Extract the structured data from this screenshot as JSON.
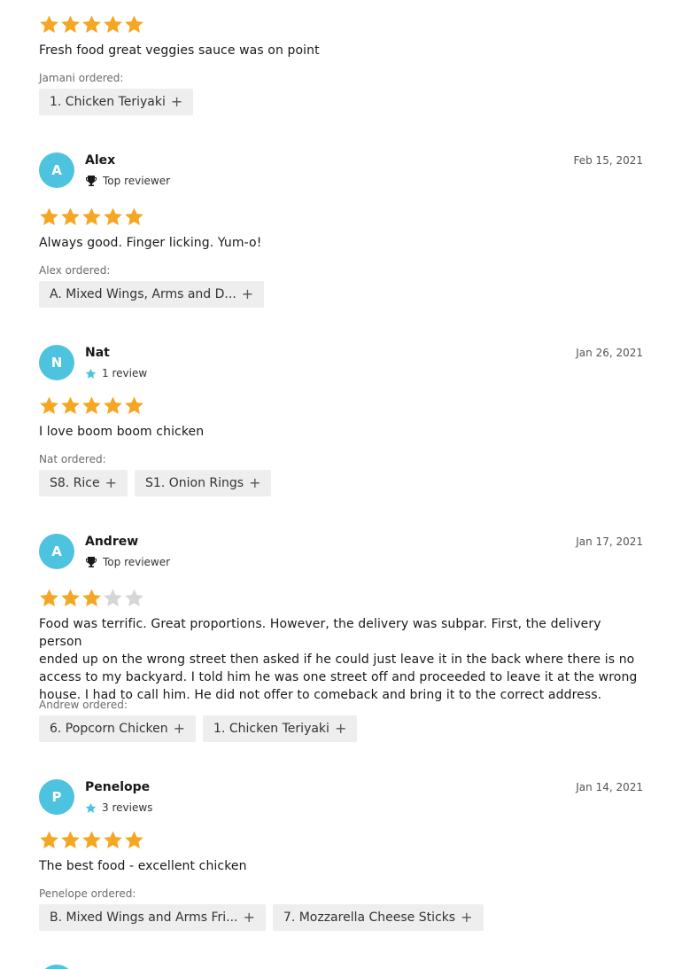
{
  "colors": {
    "star_filled": "#f5a623",
    "star_empty": "#d6d6d6",
    "avatar_bg": "#4dc3df",
    "chip_bg": "#eeeeee",
    "reviewer_star": "#4dc3df"
  },
  "first_review": {
    "rating": 5,
    "text": "Fresh food great veggies sauce was on point",
    "ordered_label": "Jamani ordered:",
    "items": [
      "1. Chicken Teriyaki"
    ]
  },
  "reviews": [
    {
      "initial": "A",
      "name": "Alex",
      "badge_icon": "trophy-icon",
      "badge_text": "Top reviewer",
      "date": "Feb 15, 2021",
      "rating": 5,
      "text": "Always good. Finger licking. Yum-o!",
      "ordered_label": "Alex ordered:",
      "items": [
        "A. Mixed Wings, Arms and D..."
      ]
    },
    {
      "initial": "N",
      "name": "Nat",
      "badge_icon": "star-icon",
      "badge_text": "1 review",
      "date": "Jan 26, 2021",
      "rating": 5,
      "text": "I love boom boom chicken",
      "ordered_label": "Nat ordered:",
      "items": [
        "S8. Rice",
        "S1. Onion Rings"
      ]
    },
    {
      "initial": "A",
      "name": "Andrew",
      "badge_icon": "trophy-icon",
      "badge_text": "Top reviewer",
      "date": "Jan 17, 2021",
      "rating": 3,
      "text_lines": [
        "Food was terrific. Great proportions. However, the delivery was subpar. First, the delivery person",
        "ended up on the wrong street then asked if he could just leave it in the back where there is no",
        "access to my backyard. I told him he was one street off and proceeded to leave it at the wrong",
        "house. I had to call him. He did not offer to comeback and bring it to the correct address."
      ],
      "ordered_label": "Andrew ordered:",
      "items": [
        "6. Popcorn Chicken",
        "1. Chicken Teriyaki"
      ]
    },
    {
      "initial": "P",
      "name": "Penelope",
      "badge_icon": "star-icon",
      "badge_text": "3 reviews",
      "date": "Jan 14, 2021",
      "rating": 5,
      "text": "The best food - excellent chicken",
      "ordered_label": "Penelope ordered:",
      "items": [
        "B. Mixed Wings and Arms Fri...",
        "7. Mozzarella Cheese Sticks"
      ]
    }
  ]
}
